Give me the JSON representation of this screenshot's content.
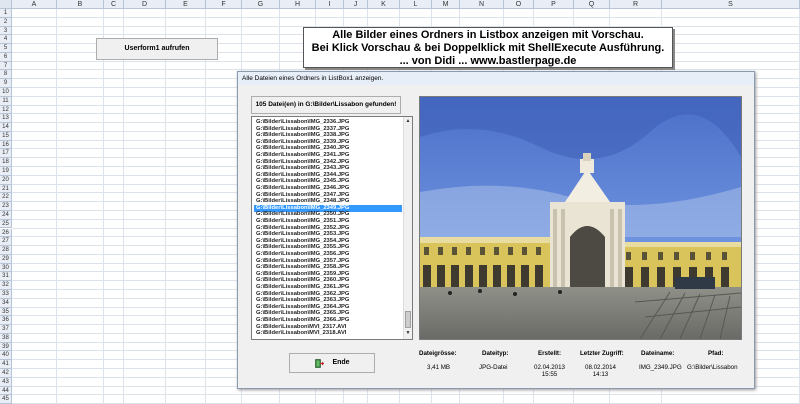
{
  "columns": [
    "A",
    "B",
    "C",
    "D",
    "E",
    "F",
    "G",
    "H",
    "I",
    "J",
    "K",
    "L",
    "M",
    "N",
    "O",
    "P",
    "Q",
    "R",
    "S"
  ],
  "rows": [
    "1",
    "2",
    "3",
    "4",
    "5",
    "6",
    "7",
    "8",
    "9",
    "10",
    "11",
    "12",
    "13",
    "14",
    "15",
    "16",
    "17",
    "18",
    "19",
    "20",
    "21",
    "22",
    "23",
    "24",
    "25",
    "26",
    "27",
    "28",
    "29",
    "30",
    "31",
    "32",
    "33",
    "34",
    "35",
    "36",
    "37",
    "38",
    "39",
    "40",
    "41",
    "42",
    "43",
    "44",
    "45"
  ],
  "sheet_button_label": "Userform1 aufrufen",
  "banner": {
    "line1": "Alle Bilder eines Ordners in Listbox anzeigen mit Vorschau.",
    "line2": "Bei Klick Vorschau & bei Doppelklick mit ShellExecute Ausführung.",
    "line3": "... von Didi ...   www.bastlerpage.de"
  },
  "form": {
    "title": "Alle Dateien eines Ordners in ListBox1 anzeigen.",
    "count_label": "105 Datei(en) in G:\\Bilder\\Lissabon gefunden!",
    "end_label": "Ende"
  },
  "listbox": {
    "items": [
      "G:\\Bilder\\Lissabon\\IMG_2336.JPG",
      "G:\\Bilder\\Lissabon\\IMG_2337.JPG",
      "G:\\Bilder\\Lissabon\\IMG_2338.JPG",
      "G:\\Bilder\\Lissabon\\IMG_2339.JPG",
      "G:\\Bilder\\Lissabon\\IMG_2340.JPG",
      "G:\\Bilder\\Lissabon\\IMG_2341.JPG",
      "G:\\Bilder\\Lissabon\\IMG_2342.JPG",
      "G:\\Bilder\\Lissabon\\IMG_2343.JPG",
      "G:\\Bilder\\Lissabon\\IMG_2344.JPG",
      "G:\\Bilder\\Lissabon\\IMG_2345.JPG",
      "G:\\Bilder\\Lissabon\\IMG_2346.JPG",
      "G:\\Bilder\\Lissabon\\IMG_2347.JPG",
      "G:\\Bilder\\Lissabon\\IMG_2348.JPG",
      "G:\\Bilder\\Lissabon\\IMG_2349.JPG",
      "G:\\Bilder\\Lissabon\\IMG_2350.JPG",
      "G:\\Bilder\\Lissabon\\IMG_2351.JPG",
      "G:\\Bilder\\Lissabon\\IMG_2352.JPG",
      "G:\\Bilder\\Lissabon\\IMG_2353.JPG",
      "G:\\Bilder\\Lissabon\\IMG_2354.JPG",
      "G:\\Bilder\\Lissabon\\IMG_2355.JPG",
      "G:\\Bilder\\Lissabon\\IMG_2356.JPG",
      "G:\\Bilder\\Lissabon\\IMG_2357.JPG",
      "G:\\Bilder\\Lissabon\\IMG_2358.JPG",
      "G:\\Bilder\\Lissabon\\IMG_2359.JPG",
      "G:\\Bilder\\Lissabon\\IMG_2360.JPG",
      "G:\\Bilder\\Lissabon\\IMG_2361.JPG",
      "G:\\Bilder\\Lissabon\\IMG_2362.JPG",
      "G:\\Bilder\\Lissabon\\IMG_2363.JPG",
      "G:\\Bilder\\Lissabon\\IMG_2364.JPG",
      "G:\\Bilder\\Lissabon\\IMG_2365.JPG",
      "G:\\Bilder\\Lissabon\\IMG_2366.JPG",
      "G:\\Bilder\\Lissabon\\MVI_2317.AVI",
      "G:\\Bilder\\Lissabon\\MVI_2318.AVI"
    ],
    "selected_index": 13
  },
  "info": {
    "headers": [
      "Dateigrösse:",
      "Dateityp:",
      "Erstellt:",
      "Letzter Zugriff:",
      "Dateiname:",
      "Pfad:"
    ],
    "size": "3,41 MB",
    "type": "JPG-Datei",
    "created_date": "02.04.2013",
    "created_time": "15:55",
    "accessed_date": "08.02.2014",
    "accessed_time": "14:13",
    "filename": "IMG_2349.JPG",
    "path": "G:\\Bilder\\Lissabon"
  },
  "icons": {
    "exit": "exit-door-icon",
    "scroll_up": "scroll-up-arrow-icon",
    "scroll_down": "scroll-down-arrow-icon"
  }
}
